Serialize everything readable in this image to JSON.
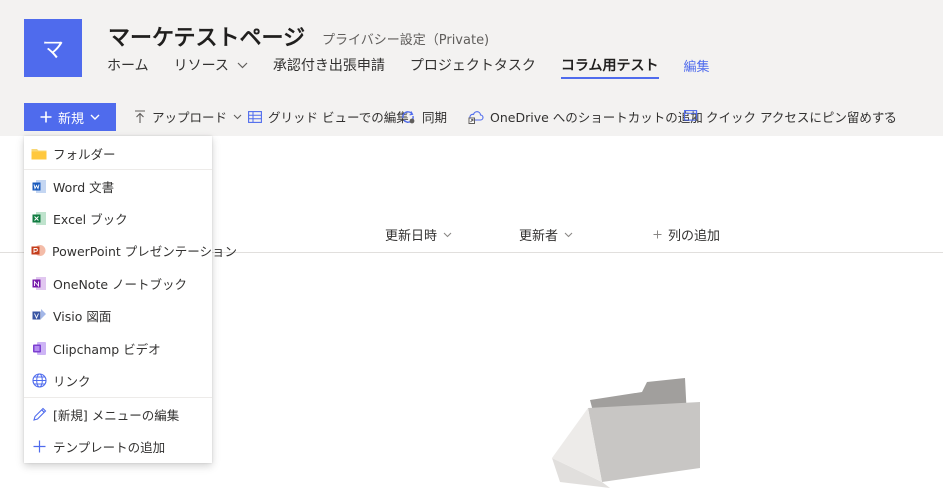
{
  "site": {
    "logo_letter": "マ",
    "title": "マーケテストページ",
    "privacy": "プライバシー設定（Private)",
    "nav": [
      {
        "label": "ホーム"
      },
      {
        "label": "リソース"
      },
      {
        "label": "承認付き出張申請"
      },
      {
        "label": "プロジェクトタスク"
      },
      {
        "label": "コラム用テスト"
      },
      {
        "label": "編集"
      }
    ]
  },
  "command_bar": {
    "new_label": "新規",
    "upload_label": "アップロード",
    "grid_edit_label": "グリッド ビューでの編集",
    "sync_label": "同期",
    "onedrive_label": "OneDrive へのショートカットの追加",
    "pin_label": "クイック アクセスにピン留めする",
    "more_label": "···"
  },
  "columns": {
    "modified": "更新日時",
    "modified_by": "更新者",
    "add_column": "列の追加"
  },
  "new_menu": {
    "items": [
      {
        "label": "フォルダー",
        "icon": "folder-icon"
      },
      {
        "label": "Word 文書",
        "icon": "word-icon"
      },
      {
        "label": "Excel ブック",
        "icon": "excel-icon"
      },
      {
        "label": "PowerPoint プレゼンテーション",
        "icon": "powerpoint-icon"
      },
      {
        "label": "OneNote ノートブック",
        "icon": "onenote-icon"
      },
      {
        "label": "Visio 図面",
        "icon": "visio-icon"
      },
      {
        "label": "Clipchamp ビデオ",
        "icon": "clipchamp-icon"
      },
      {
        "label": "リンク",
        "icon": "globe-icon"
      },
      {
        "label": "[新規] メニューの編集",
        "icon": "pencil-icon"
      },
      {
        "label": "テンプレートの追加",
        "icon": "plus-icon"
      }
    ]
  },
  "colors": {
    "accent": "#4f6bed",
    "header_bg": "#f3f2f1",
    "word": "#185abd",
    "excel": "#107c41",
    "powerpoint": "#c43e1c",
    "onenote": "#7719aa",
    "visio": "#3955a3",
    "clipchamp": "#7c3fd0",
    "folder": "#f8d775"
  }
}
